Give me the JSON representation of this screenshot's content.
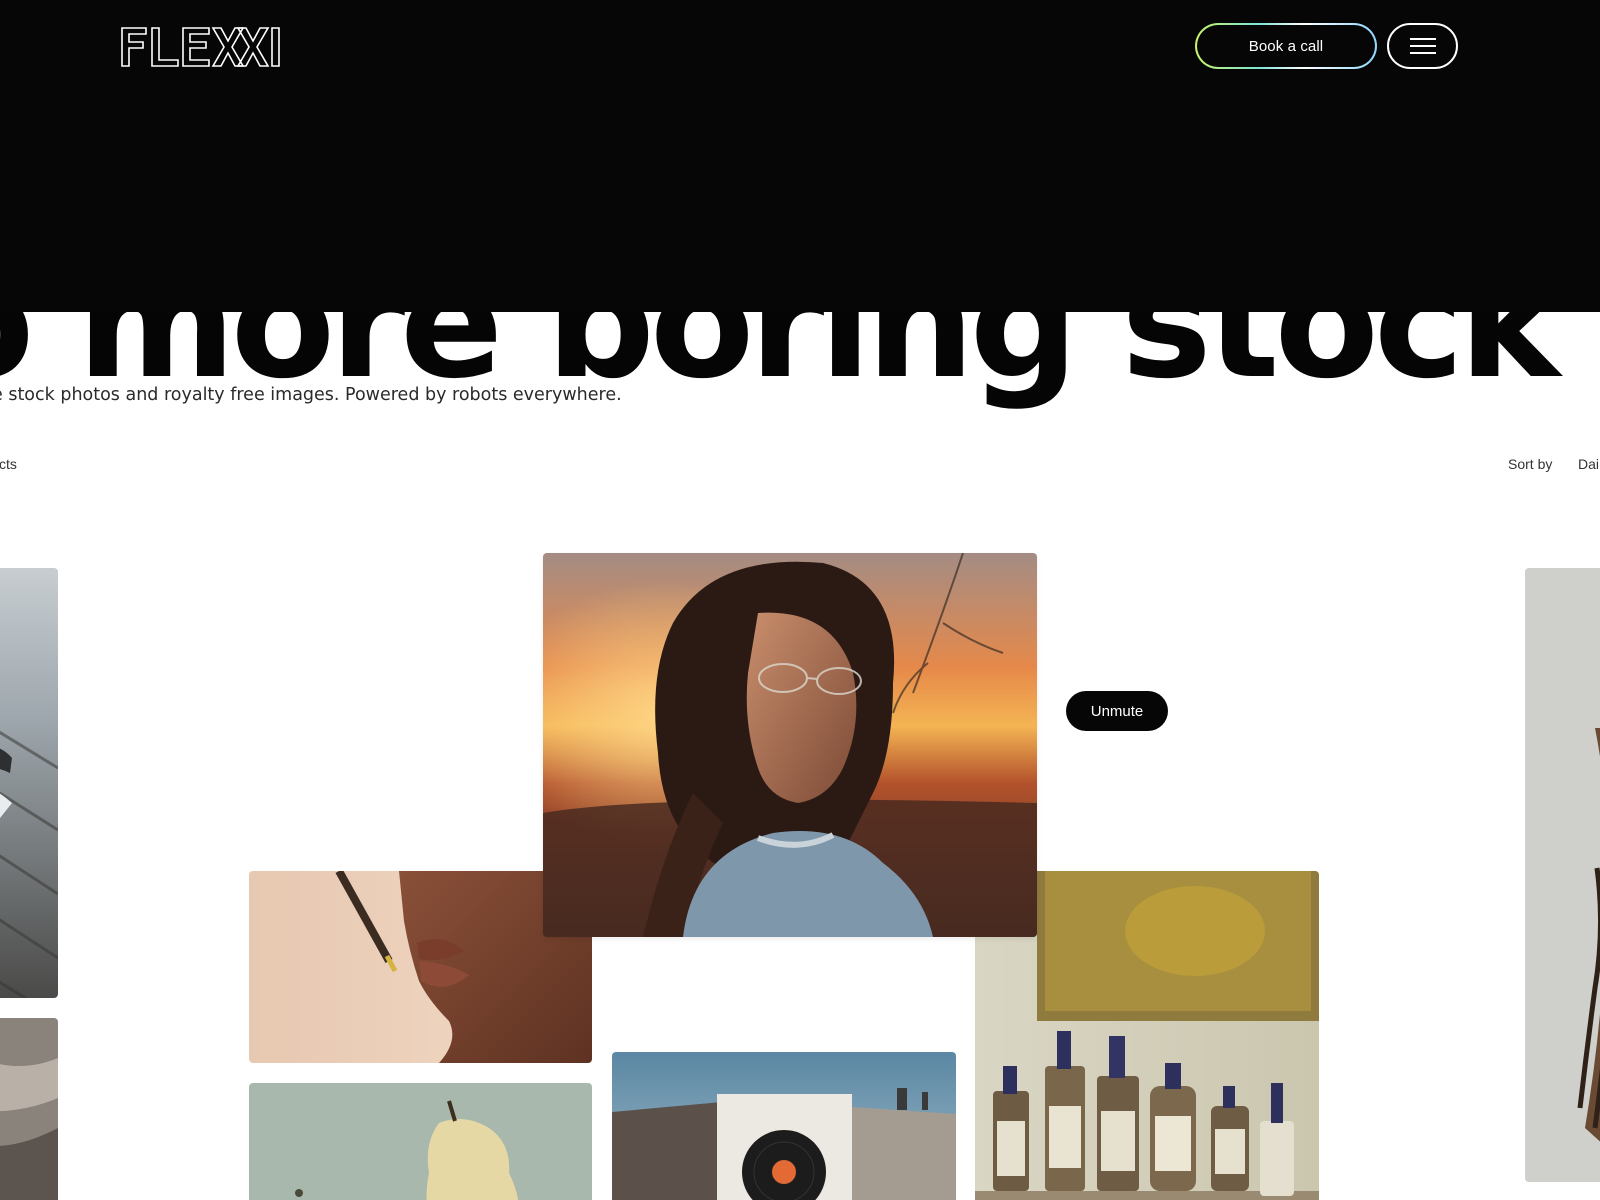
{
  "header": {
    "logo_text": "FLEXXI",
    "book_call_label": "Book a call",
    "menu_icon": "hamburger-menu-icon"
  },
  "hero": {
    "headline": "o more boring stock",
    "subline": "e stock photos and royalty free images. Powered by robots everywhere."
  },
  "filters": {
    "left_label": "cts",
    "sort_label": "Sort by",
    "sort_value": "Dai"
  },
  "gallery": {
    "unmute_label": "Unmute"
  },
  "colors": {
    "header_bg": "#060606",
    "page_bg": "#ffffff",
    "button_gradient": [
      "#c9f36a",
      "#7de3d3",
      "#ffffff",
      "#8fd7ff"
    ]
  }
}
